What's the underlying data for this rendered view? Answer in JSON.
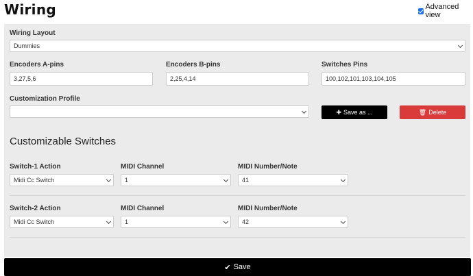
{
  "header": {
    "title": "Wiring",
    "advanced_view_label": "Advanced view",
    "advanced_view_checked": true
  },
  "layout": {
    "label": "Wiring Layout",
    "value": "Dummies"
  },
  "encoders_a": {
    "label": "Encoders A-pins",
    "value": "3,27,5,6"
  },
  "encoders_b": {
    "label": "Encoders B-pins",
    "value": "2,25,4,14"
  },
  "switches": {
    "label": "Switches Pins",
    "value": "100,102,101,103,104,105"
  },
  "profile": {
    "label": "Customization Profile",
    "value": ""
  },
  "buttons": {
    "save_as": "Save as ...",
    "delete": "Delete",
    "save": "Save"
  },
  "customizable": {
    "title": "Customizable Switches",
    "rows": [
      {
        "action_label": "Switch-1 Action",
        "action_value": "Midi Cc Switch",
        "channel_label": "MIDI Channel",
        "channel_value": "1",
        "number_label": "MIDI Number/Note",
        "number_value": "41"
      },
      {
        "action_label": "Switch-2 Action",
        "action_value": "Midi Cc Switch",
        "channel_label": "MIDI Channel",
        "channel_value": "1",
        "number_label": "MIDI Number/Note",
        "number_value": "42"
      }
    ]
  }
}
